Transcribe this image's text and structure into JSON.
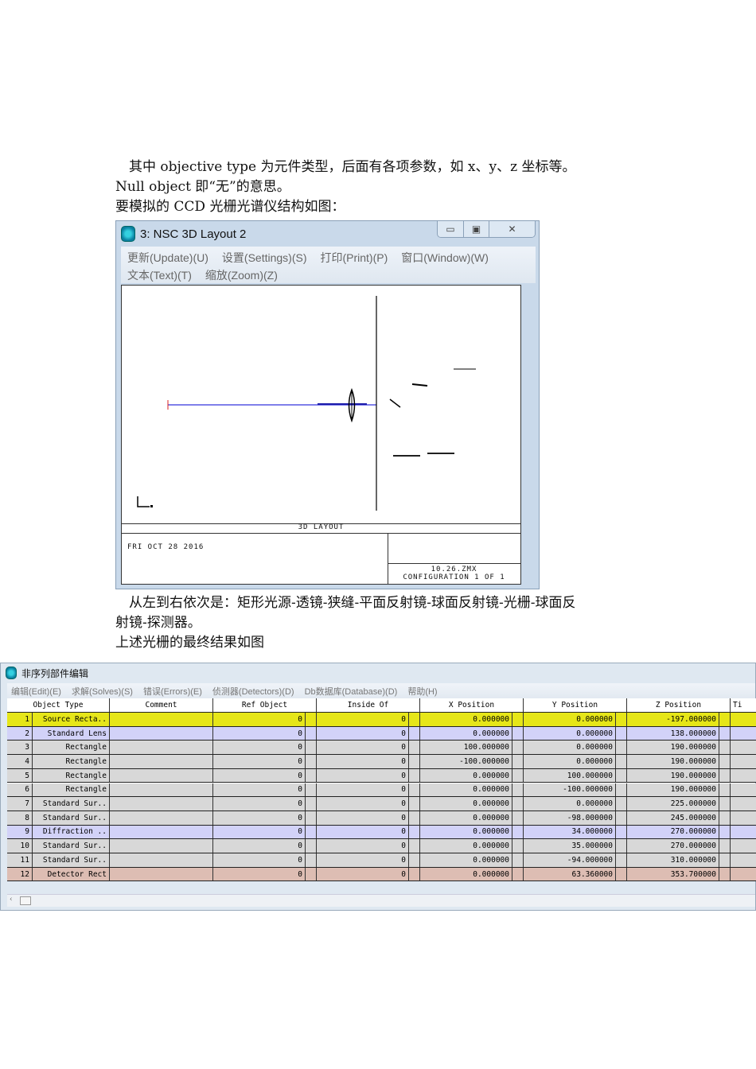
{
  "doc": {
    "para1_line1": "　其中 objective type 为元件类型，后面有各项参数，如 x、y、z 坐标等。",
    "para1_line2": "Null object 即“无”的意思。",
    "para1_line3": "要模拟的 CCD 光栅光谱仪结构如图：",
    "para2_line1": "　从左到右依次是：矩形光源-透镜-狭缝-平面反射镜-球面反射镜-光栅-球面反",
    "para2_line2": "射镜-探测器。",
    "para2_line3": "上述光栅的最终结果如图"
  },
  "layout_window": {
    "title": "3: NSC 3D Layout 2",
    "menu_row1": [
      "更新(Update)(U)",
      "设置(Settings)(S)",
      "打印(Print)(P)",
      "窗口(Window)(W)"
    ],
    "menu_row2": [
      "文本(Text)(T)",
      "缩放(Zoom)(Z)"
    ],
    "plot_title": "3D LAYOUT",
    "date": "FRI OCT 28 2016",
    "filename": "10.26.ZMX",
    "configuration": "CONFIGURATION 1 OF 1",
    "ray_color": "#3333dd"
  },
  "editor": {
    "title": "非序列部件编辑",
    "menu": [
      "编辑(Edit)(E)",
      "求解(Solves)(S)",
      "错误(Errors)(E)",
      "侦测器(Detectors)(D)",
      "Db数据库(Database)(D)",
      "帮助(H)"
    ],
    "columns": [
      "Object Type",
      "Comment",
      "Ref Object",
      "Inside Of",
      "X Position",
      "Y Position",
      "Z Position",
      "Ti"
    ],
    "rows": [
      {
        "n": "1",
        "type": "Source Recta..",
        "ref": "0",
        "inside": "0",
        "x": "0.000000",
        "y": "0.000000",
        "z": "-197.000000",
        "color": "#e6e619"
      },
      {
        "n": "2",
        "type": "Standard Lens",
        "ref": "0",
        "inside": "0",
        "x": "0.000000",
        "y": "0.000000",
        "z": "138.000000",
        "color": "#d2d2f8"
      },
      {
        "n": "3",
        "type": "Rectangle",
        "ref": "0",
        "inside": "0",
        "x": "100.000000",
        "y": "0.000000",
        "z": "190.000000",
        "color": "#d8d8d8"
      },
      {
        "n": "4",
        "type": "Rectangle",
        "ref": "0",
        "inside": "0",
        "x": "-100.000000",
        "y": "0.000000",
        "z": "190.000000",
        "color": "#d8d8d8"
      },
      {
        "n": "5",
        "type": "Rectangle",
        "ref": "0",
        "inside": "0",
        "x": "0.000000",
        "y": "100.000000",
        "z": "190.000000",
        "color": "#d8d8d8"
      },
      {
        "n": "6",
        "type": "Rectangle",
        "ref": "0",
        "inside": "0",
        "x": "0.000000",
        "y": "-100.000000",
        "z": "190.000000",
        "color": "#d8d8d8"
      },
      {
        "n": "7",
        "type": "Standard Sur..",
        "ref": "0",
        "inside": "0",
        "x": "0.000000",
        "y": "0.000000",
        "z": "225.000000",
        "color": "#d8d8d8"
      },
      {
        "n": "8",
        "type": "Standard Sur..",
        "ref": "0",
        "inside": "0",
        "x": "0.000000",
        "y": "-98.000000",
        "z": "245.000000",
        "color": "#d8d8d8"
      },
      {
        "n": "9",
        "type": "Diffraction ..",
        "ref": "0",
        "inside": "0",
        "x": "0.000000",
        "y": "34.000000",
        "z": "270.000000",
        "color": "#d2d2f8"
      },
      {
        "n": "10",
        "type": "Standard Sur..",
        "ref": "0",
        "inside": "0",
        "x": "0.000000",
        "y": "35.000000",
        "z": "270.000000",
        "color": "#d8d8d8"
      },
      {
        "n": "11",
        "type": "Standard Sur..",
        "ref": "0",
        "inside": "0",
        "x": "0.000000",
        "y": "-94.000000",
        "z": "310.000000",
        "color": "#d8d8d8"
      },
      {
        "n": "12",
        "type": "Detector Rect",
        "ref": "0",
        "inside": "0",
        "x": "0.000000",
        "y": "63.360000",
        "z": "353.700000",
        "color": "#ddbdb3"
      }
    ]
  }
}
